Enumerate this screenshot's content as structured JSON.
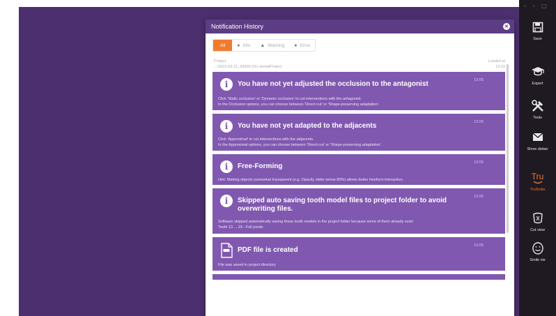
{
  "dialog": {
    "title": "Notification History",
    "filters": [
      {
        "label": "All",
        "icon": "",
        "active": true
      },
      {
        "label": "Info",
        "icon": "info-icon"
      },
      {
        "label": "Warning",
        "icon": "warning-icon"
      },
      {
        "label": "Error",
        "icon": "error-icon"
      }
    ],
    "project_label": "Project",
    "project_path": "...\\2022-03-21_99995-031.dentalProject",
    "loaded_label": "Loaded at",
    "loaded_time": "12:03"
  },
  "notifications": [
    {
      "icon": "info-icon",
      "title": "You have not yet adjusted the occlusion to the antagonist",
      "time": "13:05",
      "body": [
        "Click 'Static occlusion' or 'Dynamic occlusion' to cut intersections with the antagonist.",
        "In the Occlusion options, you can choose between 'Direct-cut' or 'Shape-preserving adaptation'."
      ]
    },
    {
      "icon": "info-icon",
      "title": "You have not yet adapted to the adjacents",
      "time": "13:05",
      "body": [
        "Click 'Approximal' to cut intersections with the adjacents.",
        "In the Approximal options, you can choose between 'Direct-cut' or 'Shape-preserving adaptation'."
      ]
    },
    {
      "icon": "info-icon",
      "title": "Free-Forming",
      "time": "13:05",
      "body": [
        "Hint: Making objects somewhat transparent (e.g. Opacity slider below 80%) allows better freeform interaction."
      ]
    },
    {
      "icon": "info-icon",
      "title": "Skipped auto saving tooth model files to project folder to avoid overwriting files.",
      "time": "13:05",
      "body": [
        "Software skipped automatically saving these tooth models in the project folder because some of them already exist:",
        "Teeth 13 ... 23 - Full pontic"
      ]
    },
    {
      "icon": "pdf-file-icon",
      "title": "PDF file is created",
      "time": "13:05",
      "body": [
        "File was saved in project directory"
      ]
    }
  ],
  "toolbar": {
    "window_controls": [
      "–",
      "–",
      "□"
    ],
    "items": [
      {
        "label": "Save",
        "icon": "save-icon"
      },
      {
        "label": "Expert",
        "icon": "graduation-cap-icon"
      },
      {
        "label": "Tools",
        "icon": "tools-icon"
      },
      {
        "label": "Show distan",
        "icon": "distance-icon"
      },
      {
        "label": "TruSmile",
        "icon": "trusmile-icon",
        "brand_text": "Tru",
        "color": "#f07b2e"
      },
      {
        "label": "Cut view",
        "icon": "cut-view-icon"
      },
      {
        "label": "Smile vie",
        "icon": "smile-view-icon"
      }
    ]
  },
  "colors": {
    "background": "#4b2f6e",
    "header": "#5c3d84",
    "card": "#8058b0",
    "accent": "#f07b2e",
    "toolbar": "#1f1a22"
  }
}
